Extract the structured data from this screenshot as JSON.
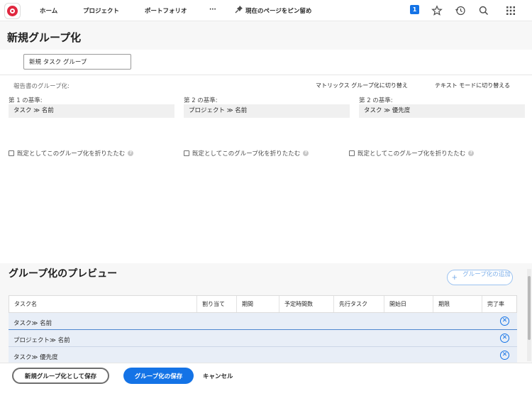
{
  "topnav": {
    "home": "ホーム",
    "projects": "プロジェクト",
    "portfolios": "ポートフォリオ",
    "more": "···",
    "pin": "現在のページをピン留め",
    "notification_count": "1",
    "icons": [
      "star-icon",
      "history-icon",
      "search-icon",
      "apps-grid-icon"
    ]
  },
  "page": {
    "title": "新規グループ化"
  },
  "name_field": {
    "value": "新規 タスク グループ"
  },
  "reporting": {
    "label": "報告書のグループ化:",
    "matrix_link": "マトリックス グループ化に切り替え",
    "text_mode_link": "テキスト モードに切り替える"
  },
  "criteria": [
    {
      "label": "第 1 の基準:",
      "value": "タスク ≫ 名前"
    },
    {
      "label": "第 2 の基準:",
      "value": "プロジェクト ≫ 名前"
    },
    {
      "label": "第 2 の基準:",
      "value": "タスク ≫ 優先度"
    }
  ],
  "collapse_label": "既定としてこのグループ化を折りたたむ",
  "help_glyph": "?",
  "preview": {
    "title": "グループ化のプレビュー",
    "add_group": "グループ化の追加",
    "columns": [
      "タスク名",
      "割り当て",
      "期間",
      "予定時間数",
      "先行タスク",
      "開始日",
      "期限",
      "完了率"
    ],
    "rows": [
      "タスク≫ 名前",
      "プロジェクト≫ 名前",
      "タスク≫ 優先度"
    ]
  },
  "footer": {
    "save_new": "新規グループ化として保存",
    "save": "グループ化の保存",
    "cancel": "キャンセル"
  },
  "colors": {
    "accent": "#1473e6",
    "logo": "#e0273f",
    "row_bg": "#e8eef7"
  }
}
